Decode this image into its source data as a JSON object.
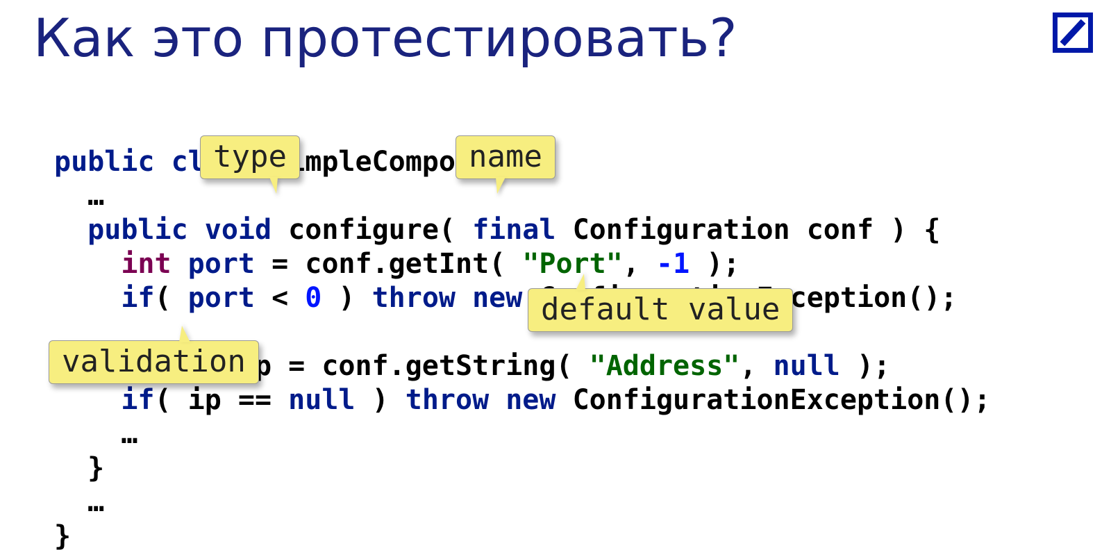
{
  "title": "Как это протестировать?",
  "logo": {
    "name": "deutsche-bank-logo",
    "stroke": "#0018a8"
  },
  "code": {
    "l1": {
      "a": "public class",
      "b": " SimpleComponent {"
    },
    "l2": "  …",
    "l3": {
      "a": "  public void",
      "b": " configure( ",
      "c": "final",
      "d": " Configuration conf ) {"
    },
    "l4": {
      "a": "    ",
      "b": "int",
      "c": " port",
      "d": " = conf.getInt( ",
      "e": "\"Port\"",
      "f": ", ",
      "g": "-1",
      "h": " );"
    },
    "l5": {
      "a": "    if",
      "b": "( ",
      "c": "port",
      "d": " < ",
      "e": "0",
      "f": " ) ",
      "g": "throw new",
      "h": " ConfigurationException();"
    },
    "l6": "",
    "l7": {
      "a": "    String ip = conf.getString( ",
      "b": "\"Address\"",
      "c": ", ",
      "d": "null",
      "e": " );"
    },
    "l8": {
      "a": "    if",
      "b": "( ip == ",
      "c": "null",
      "d": " ) ",
      "e": "throw new",
      "f": " ConfigurationException();"
    },
    "l9": "    …",
    "l10": "  }",
    "l11": "  …",
    "l12": "}"
  },
  "callouts": {
    "type": "type",
    "name": "name",
    "default": "default value",
    "validation": "validation"
  }
}
